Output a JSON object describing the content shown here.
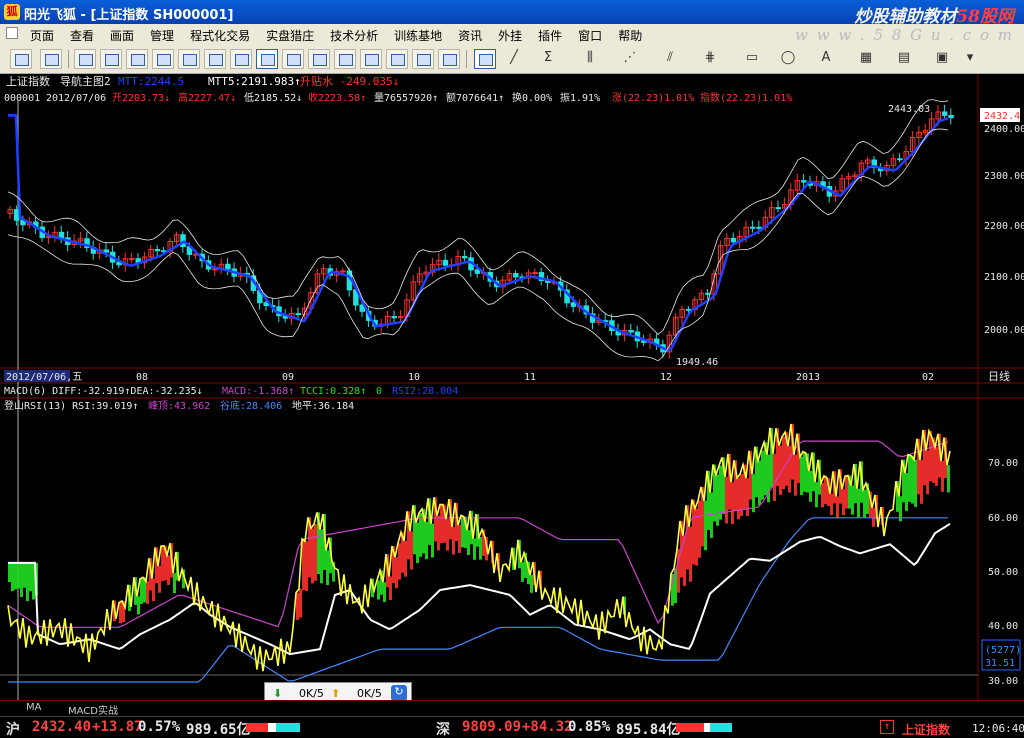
{
  "title": {
    "app": "阳光飞狐",
    "sep": "-",
    "doc": "[上证指数 SH000001]",
    "brand_cn": "炒股辅助教材",
    "brand_site": "58股网"
  },
  "menu": {
    "items": [
      "页面",
      "查看",
      "画面",
      "管理",
      "程式化交易",
      "实盘猎庄",
      "技术分析",
      "训练基地",
      "资讯",
      "外挂",
      "插件",
      "窗口",
      "帮助"
    ],
    "watermark": "w w w . 5 8 G u . c o m"
  },
  "main_chart": {
    "title": "上证指数",
    "layout": "导航主图2",
    "ind_hidden": "MTT:2244.5",
    "mtt5": "MTT5:2191.983↑",
    "signal": "升贴水 -249.035↓",
    "code": "000001",
    "date": "2012/07/06",
    "open": "开2203.73↓",
    "high": "高2227.47↓",
    "low": "低2185.52↓",
    "close": "收2223.58↑",
    "volume": "量76557920↑",
    "amount": "额7076641↑",
    "turnover": "换0.00%",
    "amplitude": "振1.91%",
    "change": "涨(22.23)1.01%",
    "index_change": "指数(22.23)1.01%",
    "y_labels": [
      "2400.00",
      "2300.00",
      "2200.00",
      "2100.00",
      "2000.00"
    ],
    "price_tag": "2432.4",
    "hi_label": "2443.03",
    "lo_label": "1949.46",
    "x_labels": [
      "2012/07/06,五",
      "08",
      "09",
      "10",
      "11",
      "12",
      "2013",
      "02"
    ],
    "period": "日线"
  },
  "sub_chart": {
    "macd_line": "MACD(6) DIFF:-32.919↑DEA:-32.235↓",
    "macd_val": "MACD:-1.368↑",
    "tcci": "TCCI:0.328↑",
    "tcci2": "0",
    "hidden": "RSI2:28.004",
    "rsi_title": "登山RSI(13) RSI:39.019↑",
    "top": "峰顶:43.962",
    "bottom": "谷底:28.406",
    "flat": "地平:36.184",
    "y_labels": [
      "70.00",
      "60.00",
      "50.00",
      "40.00",
      "30.00"
    ],
    "box_top": "(5277)",
    "box_val": "31.51"
  },
  "float_panel": {
    "down": "0K/5",
    "up": "0K/5"
  },
  "bottom_tabs": [
    "MA",
    "MACD实战"
  ],
  "status": {
    "sh": "沪",
    "sh_price": "2432.40",
    "sh_chg": "+13.87",
    "sh_pct": "0.57%",
    "sh_amt": "989.65亿",
    "sz": "深",
    "sz_price": "9809.09",
    "sz_chg": "+84.32",
    "sz_pct": "0.85%",
    "sz_amt": "895.84亿",
    "stock_name": "上证指数",
    "time": "12:06:40"
  },
  "colors": {
    "up": "#ff3030",
    "down": "#20e0e0",
    "ma": "#2040ff",
    "rsi": "#ffff40",
    "mid": "#ffffff",
    "top": "#cc44cc",
    "bottom": "#4488ff",
    "grid": "#800000"
  }
}
